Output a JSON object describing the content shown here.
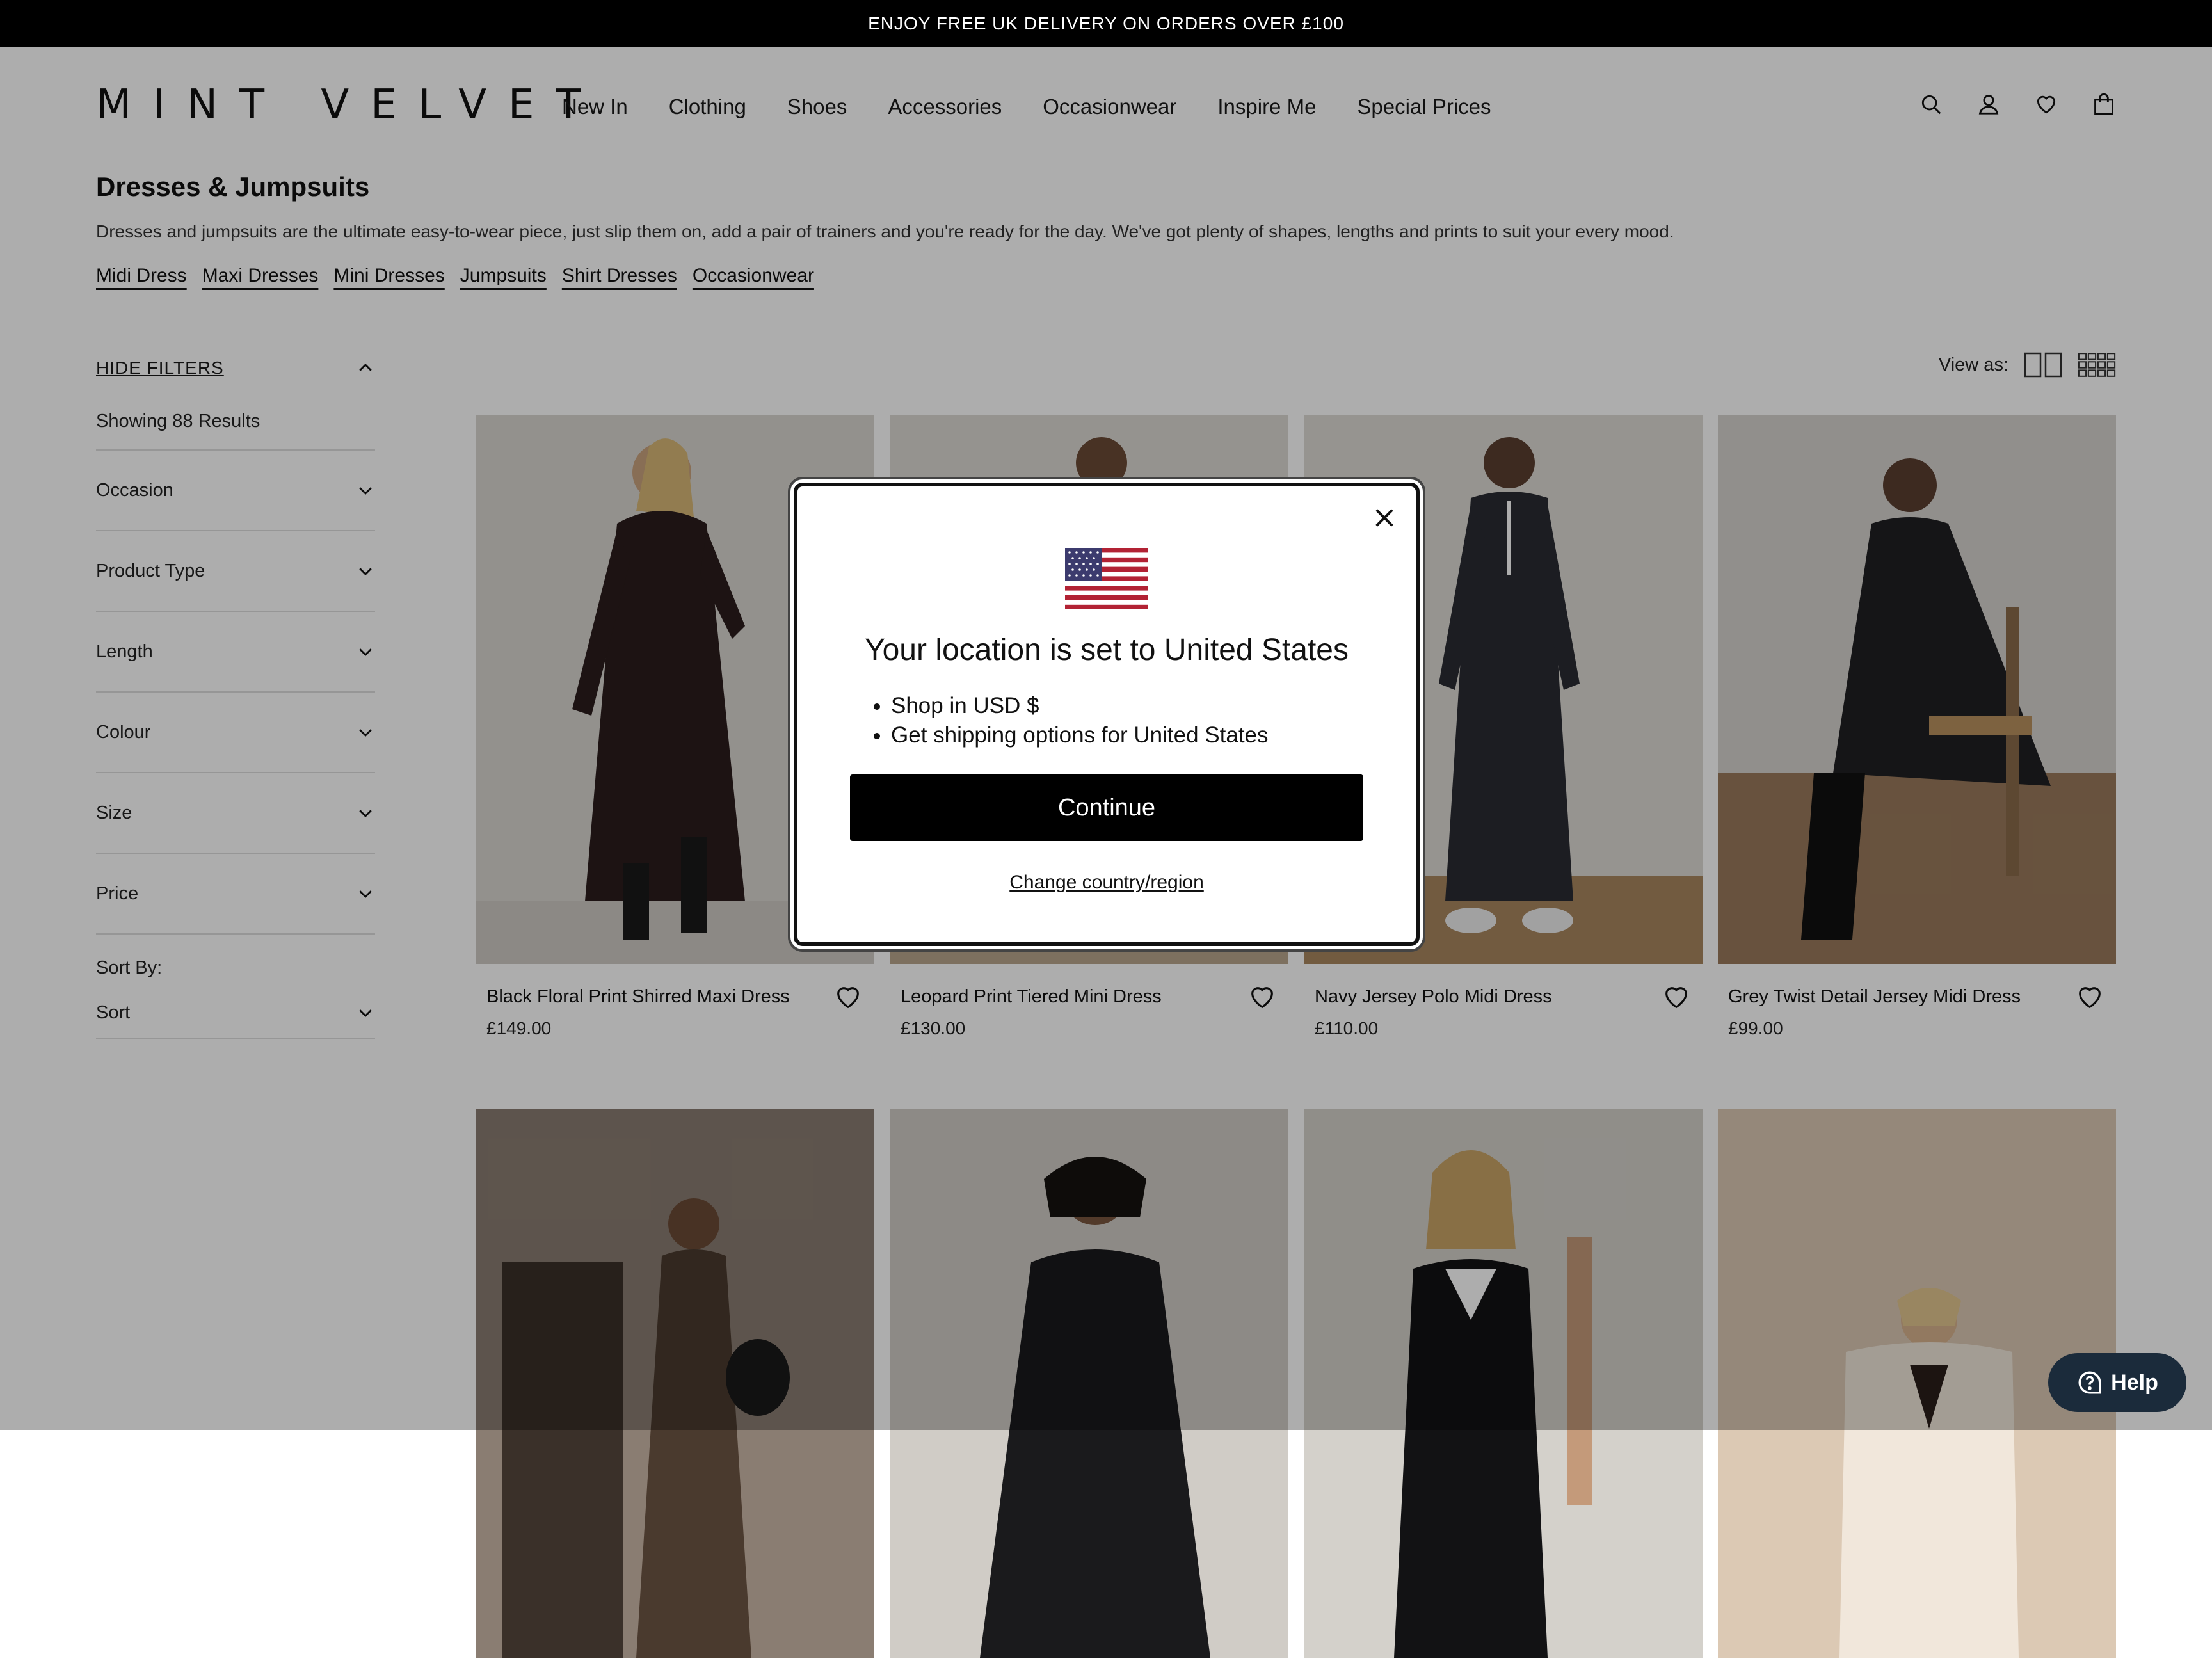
{
  "promo": {
    "text": "ENJOY FREE UK DELIVERY ON ORDERS OVER £100"
  },
  "header": {
    "logo": "MINT VELVET",
    "nav": [
      "New In",
      "Clothing",
      "Shoes",
      "Accessories",
      "Occasionwear",
      "Inspire Me",
      "Special Prices"
    ],
    "icons": [
      "search-icon",
      "account-icon",
      "wishlist-icon",
      "bag-icon"
    ]
  },
  "category": {
    "title": "Dresses & Jumpsuits",
    "description": "Dresses and jumpsuits are the ultimate easy-to-wear piece, just slip them on, add a pair of trainers and you're ready for the day. We've got plenty of shapes, lengths and prints to suit your every mood.",
    "subcategories": [
      "Midi Dress",
      "Maxi Dresses",
      "Mini Dresses",
      "Jumpsuits",
      "Shirt Dresses",
      "Occasionwear"
    ]
  },
  "filters": {
    "hide_label": "HIDE FILTERS",
    "results": "Showing 88 Results",
    "items": [
      "Occasion",
      "Product Type",
      "Length",
      "Colour",
      "Size",
      "Price"
    ],
    "sort_title": "Sort By:",
    "sort_label": "Sort"
  },
  "view_as": {
    "label": "View as:"
  },
  "products": [
    {
      "name": "Black Floral Print Shirred Maxi Dress",
      "price": "£149.00"
    },
    {
      "name": "Leopard Print Tiered Mini Dress",
      "price": "£130.00"
    },
    {
      "name": "Navy Jersey Polo Midi Dress",
      "price": "£110.00"
    },
    {
      "name": "Grey Twist Detail Jersey Midi Dress",
      "price": "£99.00"
    }
  ],
  "modal": {
    "title": "Your location is set to United States",
    "bullets": [
      "Shop in USD $",
      "Get shipping options for United States"
    ],
    "continue": "Continue",
    "change": "Change country/region"
  },
  "help": {
    "label": "Help"
  },
  "colors": {
    "promo_bg": "#000000",
    "button_bg": "#000000",
    "help_bg": "#1b2b3b"
  }
}
